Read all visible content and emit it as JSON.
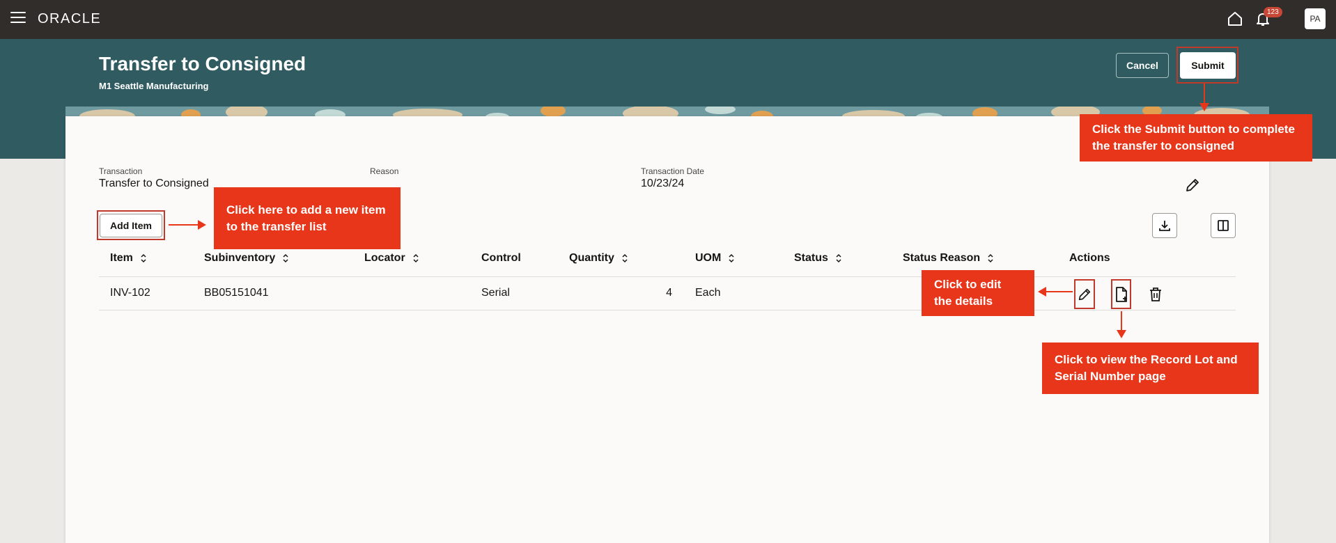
{
  "topbar": {
    "logo": "ORACLE",
    "notification_count": "123",
    "avatar_initials": "PA"
  },
  "header": {
    "title": "Transfer to Consigned",
    "subtitle": "M1 Seattle Manufacturing",
    "cancel_label": "Cancel",
    "submit_label": "Submit"
  },
  "fields": {
    "transaction_label": "Transaction",
    "transaction_value": "Transfer to Consigned",
    "reason_label": "Reason",
    "date_label": "Transaction Date",
    "date_value": "10/23/24"
  },
  "toolbar": {
    "add_item_label": "Add Item"
  },
  "table": {
    "columns": [
      "Item",
      "Subinventory",
      "Locator",
      "Control",
      "Quantity",
      "UOM",
      "Status",
      "Status Reason",
      "Actions"
    ],
    "rows": [
      {
        "item": "INV-102",
        "subinventory": "BB05151041",
        "locator": "",
        "control": "Serial",
        "quantity": "4",
        "uom": "Each",
        "status": "",
        "status_reason": ""
      }
    ]
  },
  "callouts": {
    "submit": "Click the Submit button to complete the transfer to consigned",
    "add_item": "Click here to add a new item to the transfer list",
    "edit": "Click to edit the details",
    "record": "Click to view the Record Lot and Serial Number page"
  },
  "colors": {
    "topbar": "#312d2a",
    "hero": "#2f5b61",
    "callout": "#e8361a",
    "highlight": "#c0392b"
  }
}
